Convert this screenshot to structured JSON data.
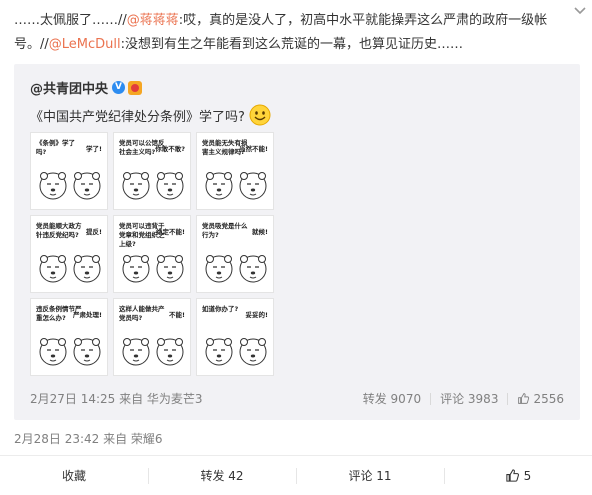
{
  "post": {
    "text_prefix": "……太佩服了……//",
    "mention1": "@蒋蒋蒋",
    "text_mid": ":哎，真的是没人了，初高中水平就能操弄这么严肃的政府一级帐号。//",
    "mention2": "@LeMcDull",
    "text_suffix": ":没想到有生之年能看到这么荒诞的一幕，也算见证历史……",
    "time": "2月28日 23:42 来自 荣耀6"
  },
  "repost": {
    "author": "@共青团中央",
    "text": "《中国共产党纪律处分条例》学了吗?",
    "time": "2月27日 14:25 来自 华为麦芒3",
    "repost_label": "转发 9070",
    "comment_label": "评论 3983",
    "like_count": "2556",
    "images": [
      {
        "q": "《条例》学了吗?",
        "a": "学了!"
      },
      {
        "q": "党员可以公馆反社会主义吗?",
        "a": "你敢不敢?"
      },
      {
        "q": "党员能无失有损害主义规律吗?",
        "a": "当然不能!"
      },
      {
        "q": "党员能顺大政方针违反党纪吗?",
        "a": "提反!"
      },
      {
        "q": "党员可以违背于党章和党组织之上级?",
        "a": "绝定不能!"
      },
      {
        "q": "党员吸党是什么行为?",
        "a": "就候!"
      },
      {
        "q": "违反条例情节严重怎么办?",
        "a": "严肃处理!"
      },
      {
        "q": "这样人能做共产党员吗?",
        "a": "不能!"
      },
      {
        "q": "如道你办了?",
        "a": "妥妥的!"
      }
    ]
  },
  "actions": {
    "collect": "收藏",
    "repost": "转发 42",
    "comment": "评论 11",
    "like": "5"
  },
  "icons": {
    "chevron": "chevron-down-icon",
    "smiley": "smiley-emoji-icon",
    "thumb": "thumbs-up-icon"
  },
  "colors": {
    "mention": "#eb7350",
    "repost_bg": "#f2f2f5",
    "verified": "#2d8cf0"
  }
}
